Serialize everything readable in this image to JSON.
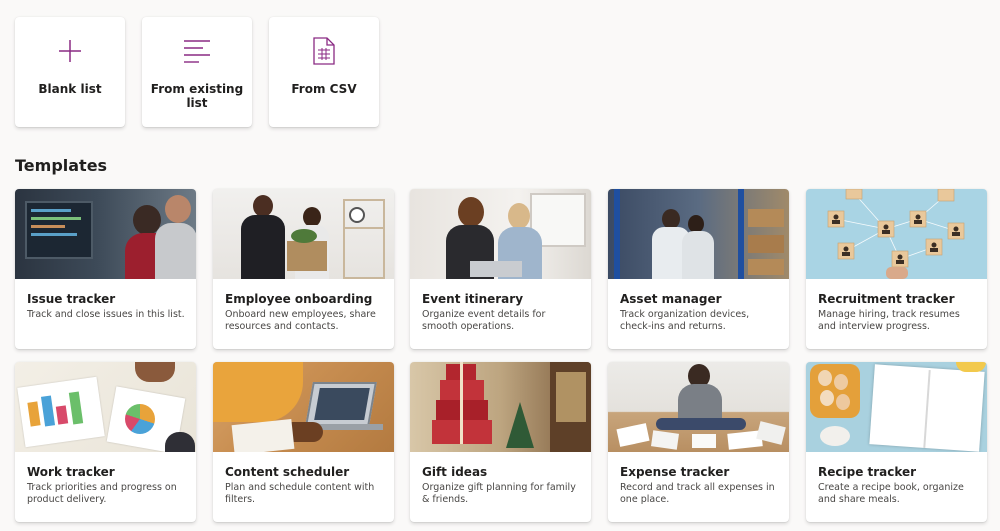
{
  "create": {
    "blank_label": "Blank list",
    "existing_label": "From existing list",
    "csv_label": "From CSV",
    "icon_color": "#8a2a83"
  },
  "templates_heading": "Templates",
  "templates": [
    {
      "title": "Issue tracker",
      "description": "Track and close issues in this list."
    },
    {
      "title": "Employee onboarding",
      "description": "Onboard new employees, share resources and contacts."
    },
    {
      "title": "Event itinerary",
      "description": "Organize event details for smooth operations."
    },
    {
      "title": "Asset manager",
      "description": "Track organization devices, check-ins and returns."
    },
    {
      "title": "Recruitment tracker",
      "description": "Manage hiring, track resumes and interview progress."
    },
    {
      "title": "Work tracker",
      "description": "Track priorities and progress on product delivery."
    },
    {
      "title": "Content scheduler",
      "description": "Plan and schedule content with filters."
    },
    {
      "title": "Gift ideas",
      "description": "Organize gift planning for family & friends."
    },
    {
      "title": "Expense tracker",
      "description": "Record and track all expenses in one place."
    },
    {
      "title": "Recipe tracker",
      "description": "Create a recipe book, organize and share meals."
    }
  ]
}
